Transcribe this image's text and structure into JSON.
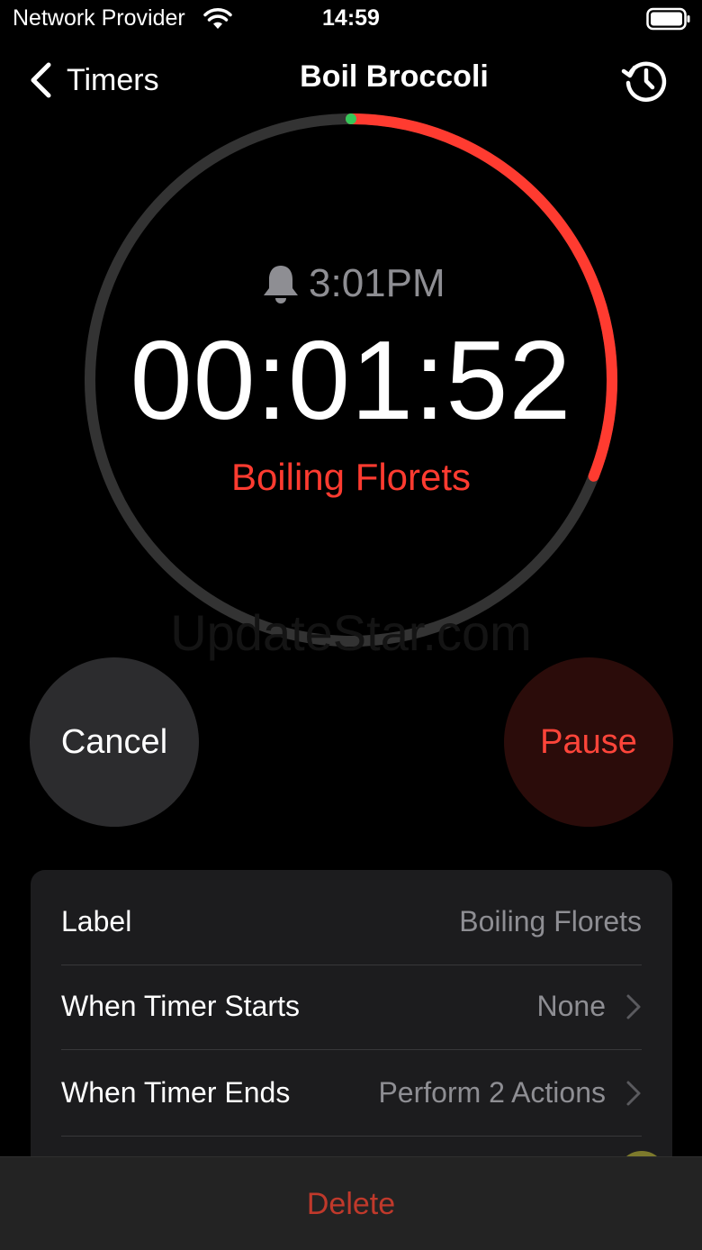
{
  "status_bar": {
    "carrier": "Network Provider",
    "time": "14:59",
    "wifi_icon": "wifi-icon",
    "battery_icon": "battery-icon"
  },
  "nav": {
    "back_label": "Timers",
    "title": "Boil Broccoli",
    "history_icon": "history-icon"
  },
  "timer": {
    "alarm_time": "3:01PM",
    "countdown": "00:01:52",
    "label": "Boiling Florets",
    "progress_remaining": 0.31,
    "colors": {
      "progress": "#ff3b30",
      "track": "#333333",
      "start_marker": "#34c759"
    }
  },
  "watermark": "UpdateStar.com",
  "buttons": {
    "cancel": "Cancel",
    "pause": "Pause"
  },
  "settings": {
    "rows": [
      {
        "title": "Label",
        "value": "Boiling Florets"
      },
      {
        "title": "When Timer Starts",
        "value": "None"
      },
      {
        "title": "When Timer Ends",
        "value": "Perform 2 Actions"
      }
    ]
  },
  "bottom": {
    "delete": "Delete"
  },
  "colors": {
    "accent": "#ff3b30",
    "background": "#000000",
    "card": "#1c1c1e"
  }
}
